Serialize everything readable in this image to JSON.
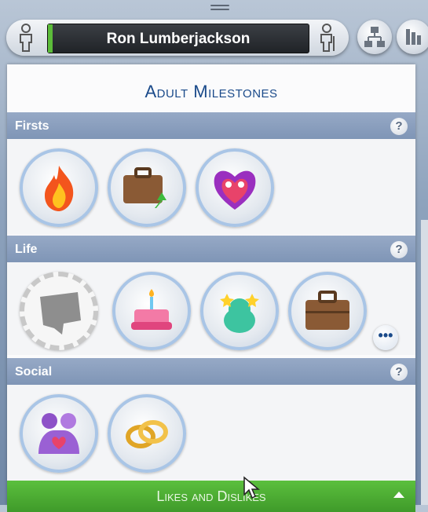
{
  "header": {
    "sim_name": "Ron Lumberjackson",
    "left_icon": "adult-sim-icon",
    "right_icon": "elder-sim-icon",
    "buttons": [
      {
        "icon": "family-tree-icon"
      },
      {
        "icon": "stats-icon"
      }
    ]
  },
  "panel": {
    "title": "Adult Milestones",
    "sections": [
      {
        "label": "Firsts",
        "help": "?",
        "milestones": [
          {
            "icon": "fire-icon"
          },
          {
            "icon": "briefcase-promotion-icon"
          },
          {
            "icon": "heart-monster-icon"
          }
        ]
      },
      {
        "label": "Life",
        "help": "?",
        "more": "•••",
        "milestones": [
          {
            "icon": "locked-milestone-icon"
          },
          {
            "icon": "birthday-cake-icon"
          },
          {
            "icon": "celebrity-stars-icon"
          },
          {
            "icon": "briefcase-icon"
          }
        ]
      },
      {
        "label": "Social",
        "help": "?",
        "milestones": [
          {
            "icon": "hugging-couple-icon"
          },
          {
            "icon": "wedding-rings-icon"
          }
        ]
      }
    ]
  },
  "footer": {
    "label": "Likes and Dislikes"
  }
}
